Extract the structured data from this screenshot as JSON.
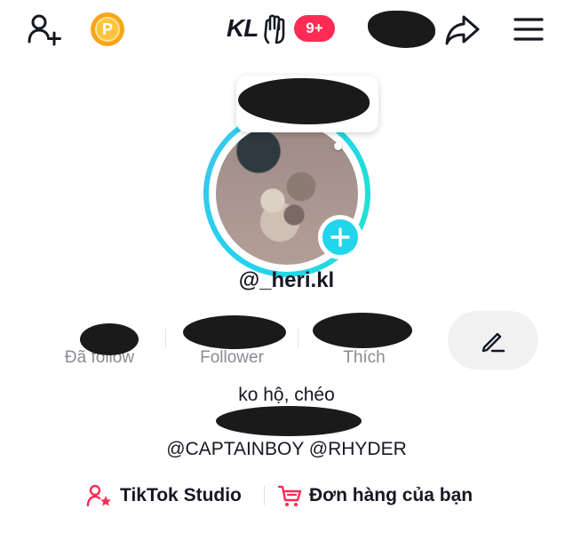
{
  "topbar": {
    "username_short": "KL",
    "notification_count": "9+",
    "coin_letter": "P"
  },
  "profile": {
    "handle": "@_heri.kl"
  },
  "stats": {
    "following_label": "Đã follow",
    "followers_label": "Follower",
    "likes_label": "Thích"
  },
  "bio": {
    "line1": "ko hộ, chéo",
    "line3": "@CAPTAINBOY @RHYDER"
  },
  "links": {
    "studio": "TikTok Studio",
    "orders": "Đơn hàng của bạn"
  },
  "colors": {
    "accent_cyan": "#20d5ec",
    "badge_red": "#fe2c55",
    "coin_orange": "#f7a51b",
    "text_primary": "#161823",
    "text_secondary": "#8a8b91"
  }
}
